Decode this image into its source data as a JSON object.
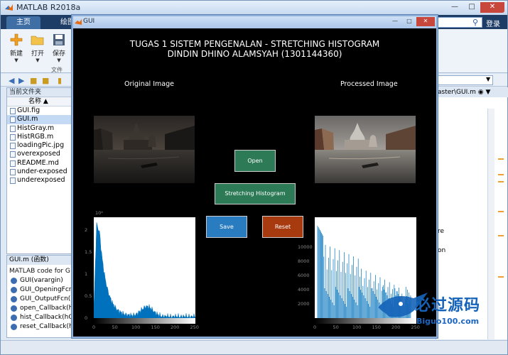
{
  "matlab": {
    "title": "MATLAB R2018a",
    "tabs": {
      "home": "主页",
      "plot": "绘图"
    },
    "login": "登录",
    "ribbon": {
      "new_label": "新建",
      "open_label": "打开",
      "save_label": "保存",
      "group_label": "文件"
    },
    "current_folder": {
      "header": "当前文件夹",
      "name_column": "名称",
      "files": [
        "GUI.fig",
        "GUI.m",
        "HistGray.m",
        "HistRGB.m",
        "loadingPic.jpg",
        "overexposed",
        "README.md",
        "under-exposed",
        "underexposed"
      ]
    },
    "details": {
      "header": "GUI.m  (函数)",
      "description": "MATLAB code for G",
      "functions": [
        "GUI(varargin)",
        "GUI_OpeningFcn(",
        "GUI_OutputFcn(h",
        "open_Callback(h",
        "hist_Callback(hO",
        "reset_Callback(h"
      ]
    },
    "editor": {
      "tab_label": "aster\\GUI.m",
      "fragment_1": "re",
      "fragment_2": "on"
    }
  },
  "gui": {
    "title": "GUI",
    "heading_line1": "TUGAS 1 SISTEM PENGENALAN - STRETCHING HISTOGRAM",
    "heading_line2": "DINDIN DHINO ALAMSYAH (1301144360)",
    "original_label": "Original Image",
    "processed_label": "Processed Image",
    "buttons": {
      "open": "Open",
      "stretch": "Stretching Histogram",
      "save": "Save",
      "reset": "Reset"
    },
    "hist_orig_yticks": [
      "2",
      "1.5",
      "1",
      "0.5",
      "0"
    ],
    "hist_orig_exp": "10⁴",
    "hist_proc_yticks": [
      "10000",
      "8000",
      "6000",
      "4000",
      "2000"
    ],
    "xticks": [
      "0",
      "50",
      "100",
      "150",
      "200",
      "250"
    ]
  },
  "watermark": {
    "text": "必过源码",
    "url": "Biguo100.com"
  },
  "colors": {
    "open_btn": "#2d7a57",
    "save_btn": "#2a7cc1",
    "reset_btn": "#a83a0f",
    "hist_fill": "#0072bd"
  }
}
